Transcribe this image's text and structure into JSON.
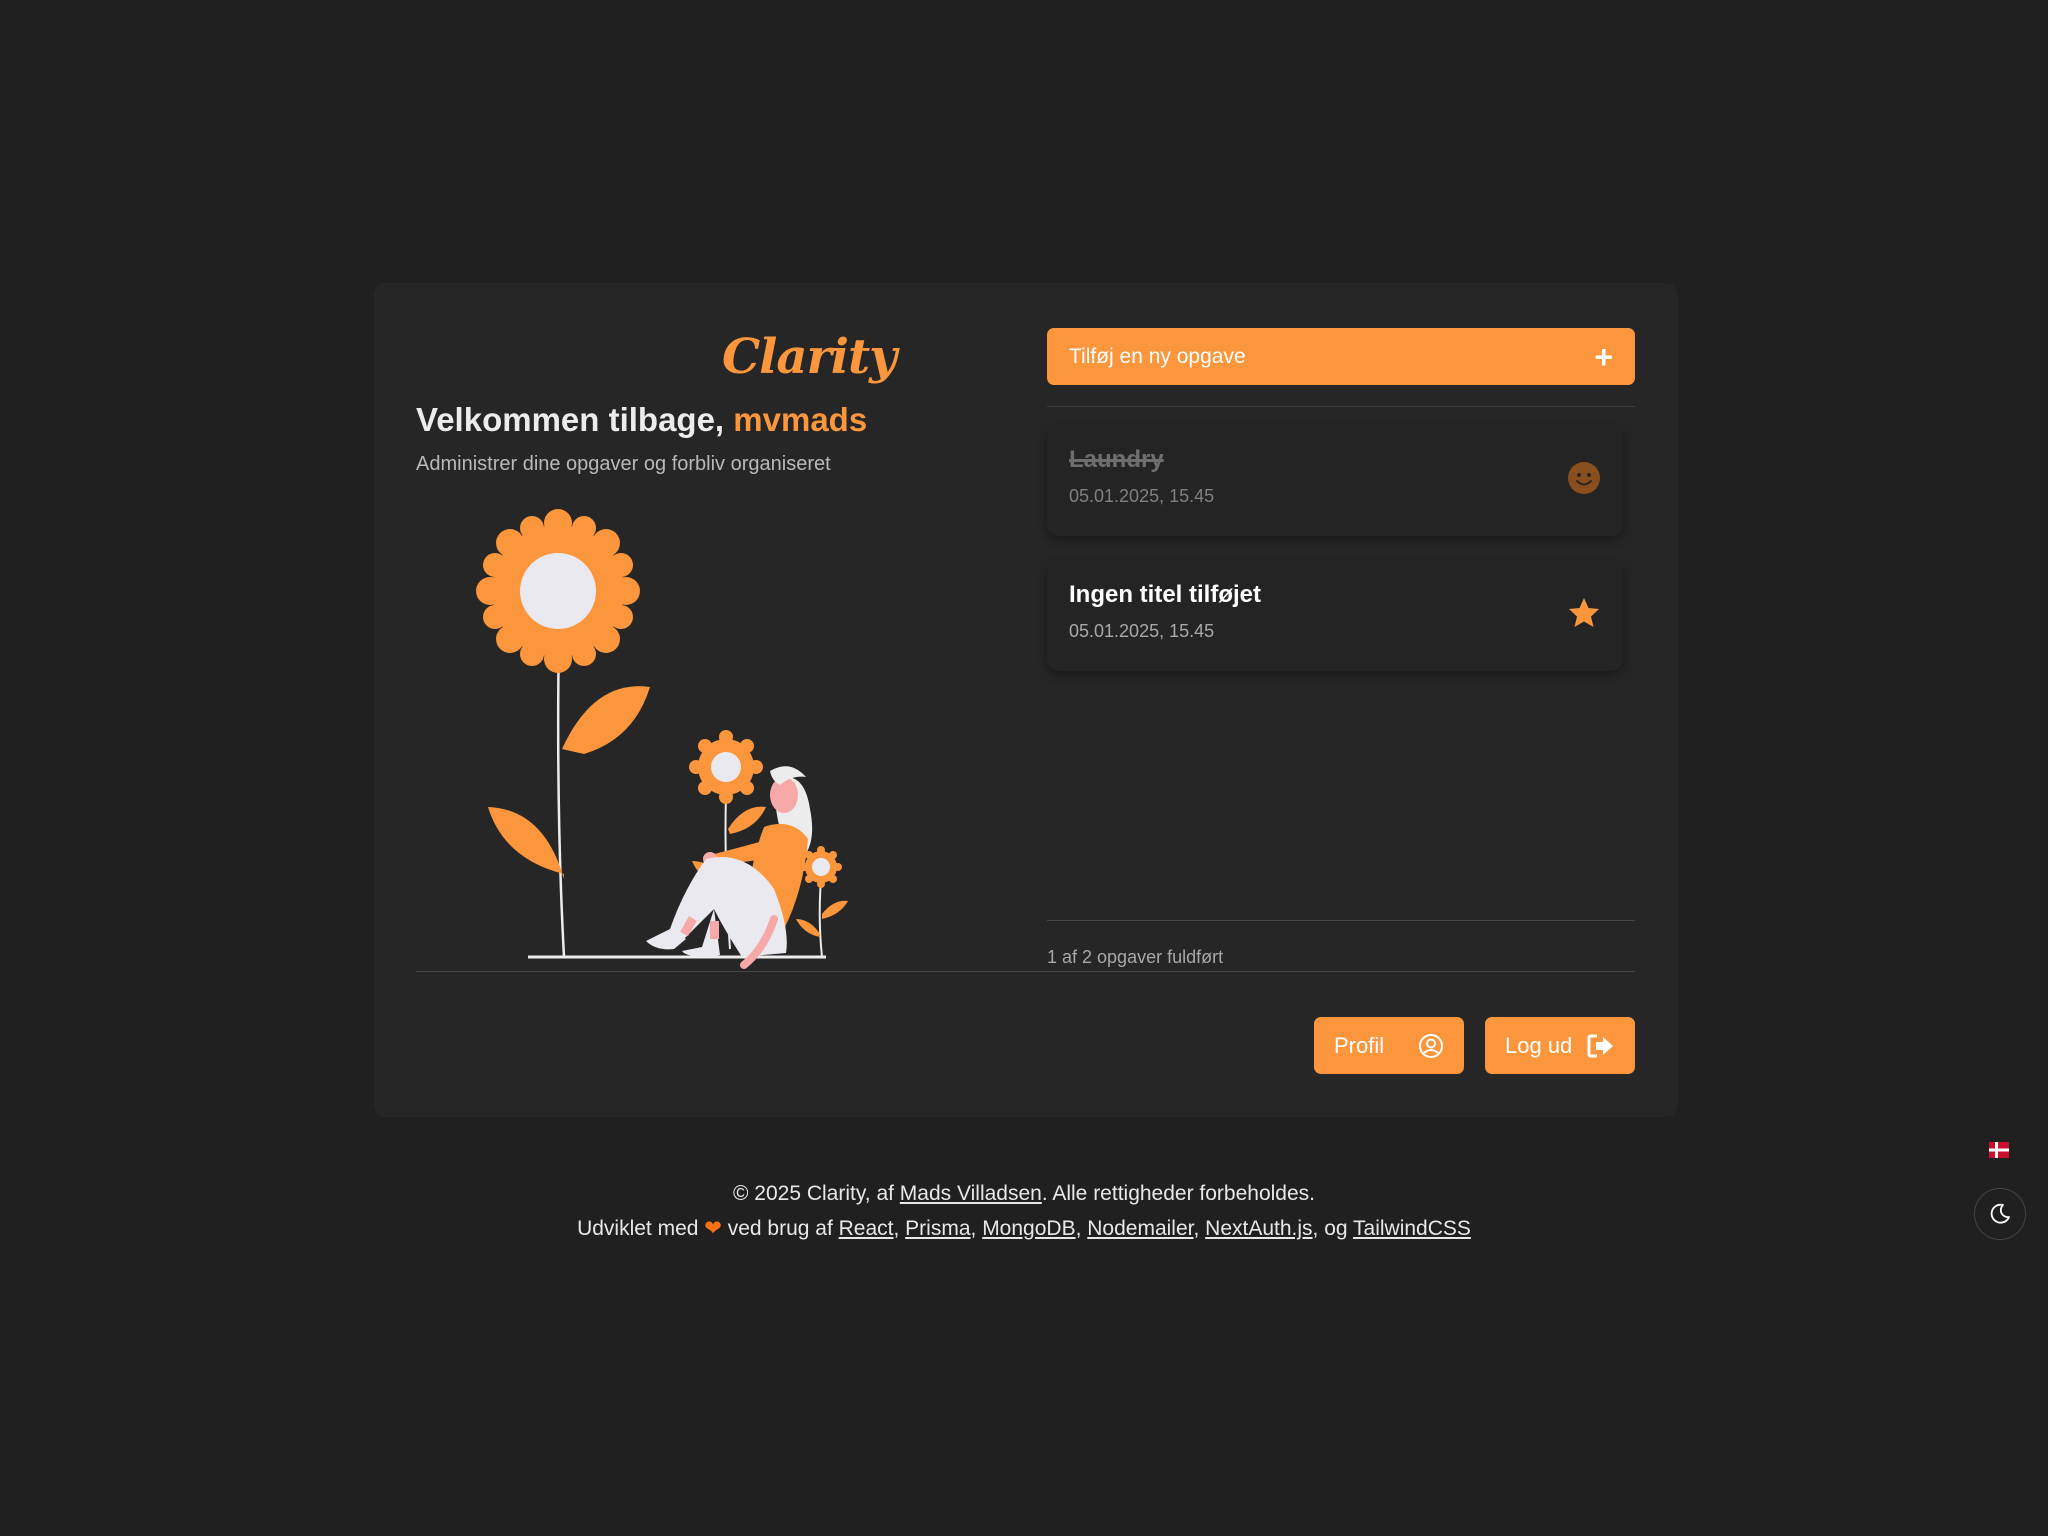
{
  "app": {
    "logo": "Clarity",
    "welcome_prefix": "Velkommen tilbage, ",
    "username": "mvmads",
    "subtitle": "Administrer dine opgaver og forbliv organiseret"
  },
  "tasks": {
    "add_label": "Tilføj en ny opgave",
    "add_icon": "plus-icon",
    "items": [
      {
        "title": "Laundry",
        "date": "05.01.2025, 15.45",
        "completed": true,
        "icon": "smiley-icon"
      },
      {
        "title": "Ingen titel tilføjet",
        "date": "05.01.2025, 15.45",
        "completed": false,
        "icon": "star-icon"
      }
    ],
    "progress_text": "1 af 2 opgaver fuldført"
  },
  "actions": {
    "profile_label": "Profil",
    "profile_icon": "user-circle-icon",
    "logout_label": "Log ud",
    "logout_icon": "sign-out-icon"
  },
  "footer": {
    "copyright_prefix": "© 2025 Clarity, af ",
    "author": "Mads Villadsen",
    "copyright_suffix": ". Alle rettigheder forbeholdes.",
    "made_with_prefix": "Udviklet med ",
    "made_with_middle": " ved brug af ",
    "tech": [
      "React",
      "Prisma",
      "MongoDB",
      "Nodemailer",
      "NextAuth.js",
      "TailwindCSS"
    ],
    "og": ", og "
  },
  "colors": {
    "accent": "#fb963c",
    "background": "#202020",
    "card": "#262626"
  }
}
